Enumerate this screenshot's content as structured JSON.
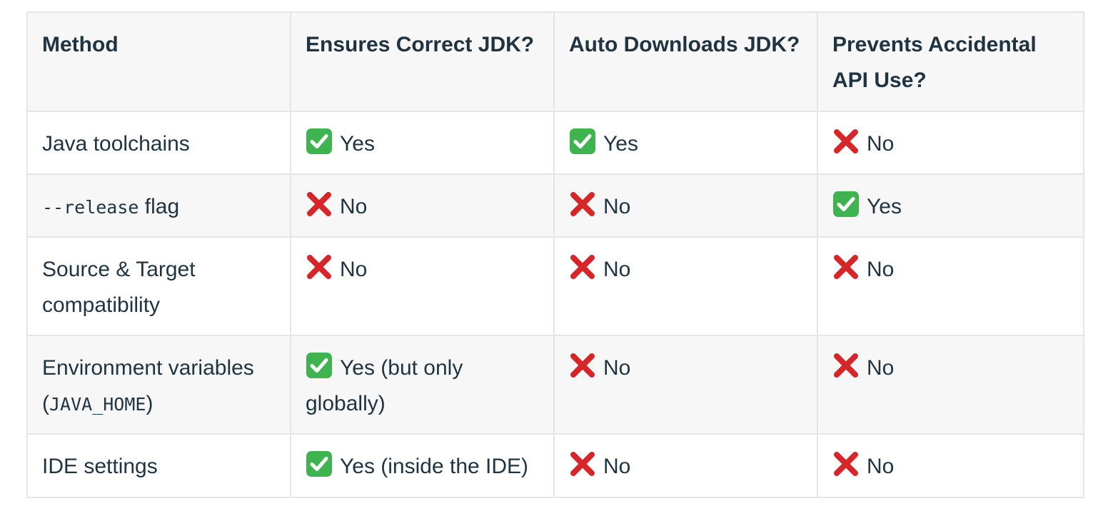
{
  "table": {
    "headers": [
      "Method",
      "Ensures Correct JDK?",
      "Auto Downloads JDK?",
      "Prevents Accidental API Use?"
    ],
    "rows": [
      {
        "method": {
          "text": "Java toolchains"
        },
        "cells": [
          {
            "icon": "check-icon",
            "text": "Yes"
          },
          {
            "icon": "check-icon",
            "text": "Yes"
          },
          {
            "icon": "cross-icon",
            "text": "No"
          }
        ]
      },
      {
        "method": {
          "code": "--release",
          "text": " flag"
        },
        "cells": [
          {
            "icon": "cross-icon",
            "text": "No"
          },
          {
            "icon": "cross-icon",
            "text": "No"
          },
          {
            "icon": "check-icon",
            "text": "Yes"
          }
        ]
      },
      {
        "method": {
          "text": "Source & Target compatibility"
        },
        "cells": [
          {
            "icon": "cross-icon",
            "text": "No"
          },
          {
            "icon": "cross-icon",
            "text": "No"
          },
          {
            "icon": "cross-icon",
            "text": "No"
          }
        ]
      },
      {
        "method": {
          "text": "Environment variables",
          "open": "(",
          "code": "JAVA_HOME",
          "close": ")"
        },
        "cells": [
          {
            "icon": "check-icon",
            "text": "Yes (but only globally)"
          },
          {
            "icon": "cross-icon",
            "text": "No"
          },
          {
            "icon": "cross-icon",
            "text": "No"
          }
        ]
      },
      {
        "method": {
          "text": "IDE settings"
        },
        "cells": [
          {
            "icon": "check-icon",
            "text": "Yes (inside the IDE)"
          },
          {
            "icon": "cross-icon",
            "text": "No"
          },
          {
            "icon": "cross-icon",
            "text": "No"
          }
        ]
      }
    ]
  },
  "colors": {
    "text": "#1f3340",
    "border": "#e3e5e7",
    "header_bg": "#f7f7f7",
    "check_green": "#3fb34f",
    "cross_red": "#d7262a"
  }
}
